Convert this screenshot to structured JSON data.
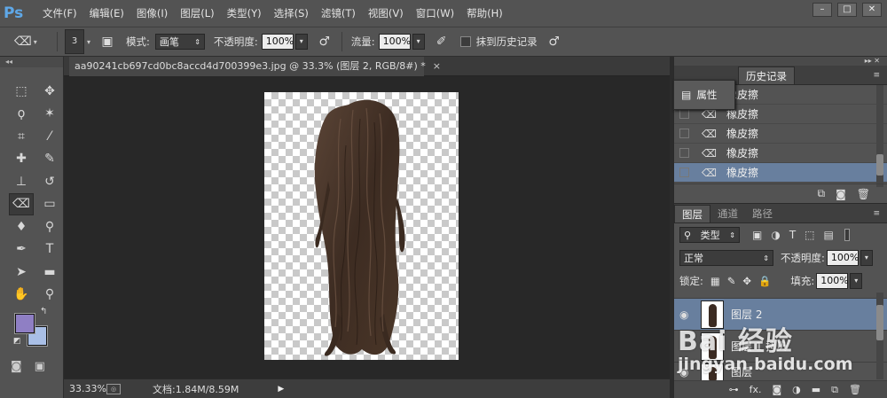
{
  "app": {
    "logo": "Ps",
    "menu": [
      "文件(F)",
      "编辑(E)",
      "图像(I)",
      "图层(L)",
      "类型(Y)",
      "选择(S)",
      "滤镜(T)",
      "视图(V)",
      "窗口(W)",
      "帮助(H)"
    ],
    "window_controls": [
      "–",
      "□",
      "✕"
    ]
  },
  "options_bar": {
    "brush_size": "3",
    "mode_label": "模式:",
    "mode_value": "画笔",
    "opacity_label": "不透明度:",
    "opacity_value": "100%",
    "flow_label": "流量:",
    "flow_value": "100%",
    "erase_history_label": "抹到历史记录"
  },
  "document": {
    "tab_title": "aa90241cb697cd0bc8accd4d700399e3.jpg @ 33.3% (图层 2, RGB/8#) *",
    "tab_close": "×"
  },
  "status_bar": {
    "zoom": "33.33%",
    "doc_size": "文档:1.84M/8.59M"
  },
  "colors": {
    "foreground": "#8f7fc4",
    "background": "#a9bfe6",
    "selection_highlight": "#687f9e"
  },
  "history_panel": {
    "tab_history": "历史记录",
    "attr_popup_label": "属性",
    "rows": [
      "橡皮擦",
      "橡皮擦",
      "橡皮擦",
      "橡皮擦",
      "橡皮擦"
    ],
    "selected_index": 4
  },
  "layers_panel": {
    "tabs": [
      "图层",
      "通道",
      "路径"
    ],
    "filter_type": "类型",
    "blend_mode": "正常",
    "opacity_label": "不透明度:",
    "opacity_value": "100%",
    "lock_label": "锁定:",
    "fill_label": "填充:",
    "fill_value": "100%",
    "layers": [
      {
        "name": "图层 2",
        "selected": true
      },
      {
        "name": "图层 1 拷贝",
        "selected": false
      },
      {
        "name": "图层",
        "selected": false
      }
    ],
    "footer_icons": [
      "link-icon",
      "fx-icon",
      "mask-icon",
      "adjustment-icon",
      "group-icon",
      "new-layer-icon",
      "trash-icon"
    ],
    "fx_label": "fx."
  },
  "watermark": {
    "main": "Bai 经验",
    "sub": "jingyan.baidu.com"
  }
}
